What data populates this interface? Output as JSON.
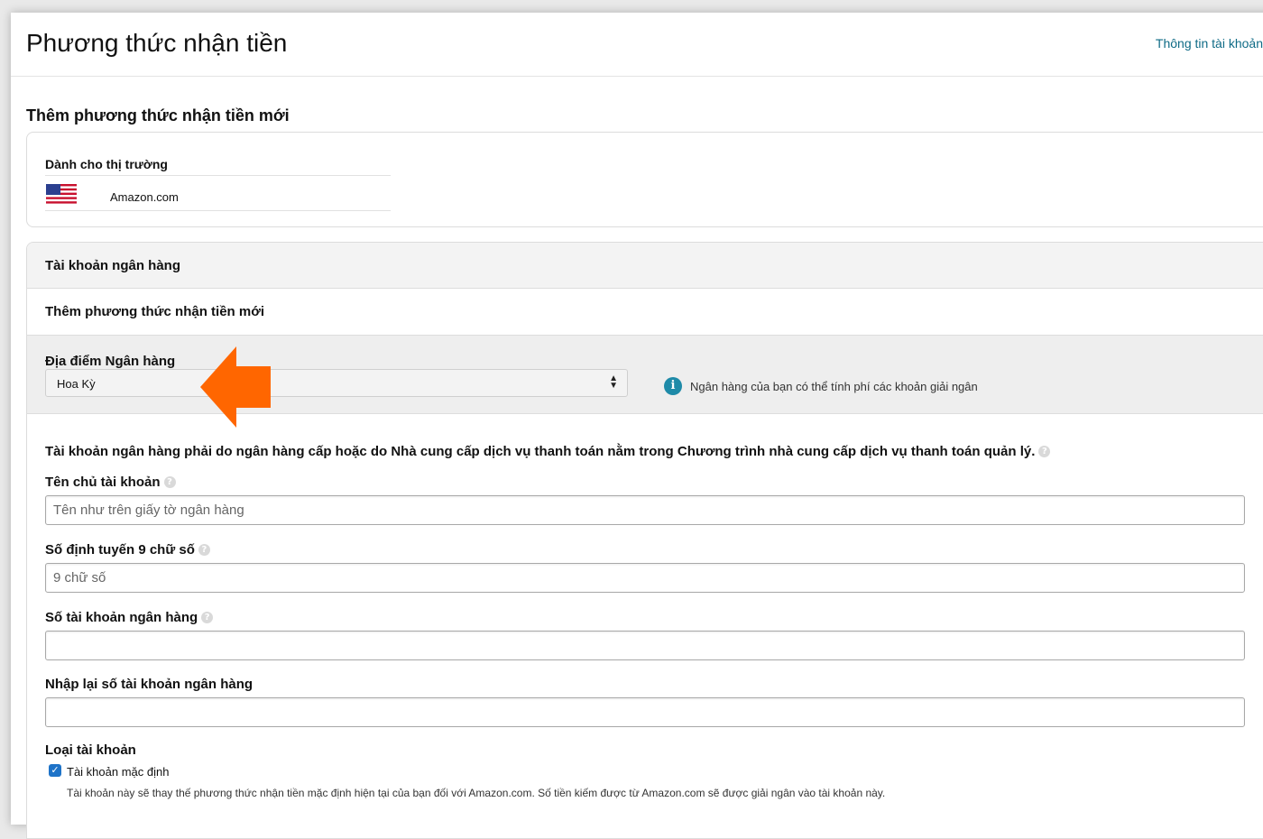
{
  "page": {
    "title": "Phương thức nhận tiền",
    "account_link": "Thông tin tài khoản"
  },
  "add_section": {
    "title": "Thêm phương thức nhận tiền mới"
  },
  "marketplace": {
    "label": "Dành cho thị trường",
    "flag_icon": "us-flag-icon",
    "value": "Amazon.com"
  },
  "bank": {
    "header": "Tài khoản ngân hàng",
    "add_row": "Thêm phương thức nhận tiền mới",
    "location": {
      "label": "Địa điểm Ngân hàng",
      "selected": "Hoa Kỳ",
      "info_icon": "info-icon",
      "info_text": "Ngân hàng của bạn có thể tính phí các khoản giải ngân"
    },
    "notice": "Tài khoản ngân hàng phải do ngân hàng cấp hoặc do Nhà cung cấp dịch vụ thanh toán nằm trong Chương trình nhà cung cấp dịch vụ thanh toán quản lý.",
    "fields": {
      "holder_label": "Tên chủ tài khoản",
      "holder_placeholder": "Tên như trên giấy tờ ngân hàng",
      "routing_label": "Số định tuyến 9 chữ số",
      "routing_placeholder": "9 chữ số",
      "account_label": "Số tài khoản ngân hàng",
      "account_placeholder": "",
      "reenter_label": "Nhập lại số tài khoản ngân hàng",
      "reenter_placeholder": ""
    },
    "account_type": {
      "label": "Loại tài khoản",
      "default_checkbox_label": "Tài khoản mặc định",
      "default_checked": true,
      "default_desc": "Tài khoản này sẽ thay thế phương thức nhận tiền mặc định hiện tại của bạn đối với Amazon.com. Số tiền kiếm được từ Amazon.com sẽ được giải ngân vào tài khoản này."
    }
  },
  "annotation": {
    "arrow_icon": "orange-arrow-icon",
    "arrow_color": "#ff6600"
  },
  "colors": {
    "link": "#0f6b86",
    "info": "#1e8aa8",
    "checkbox": "#1e73c8",
    "band": "#eeeeee"
  }
}
